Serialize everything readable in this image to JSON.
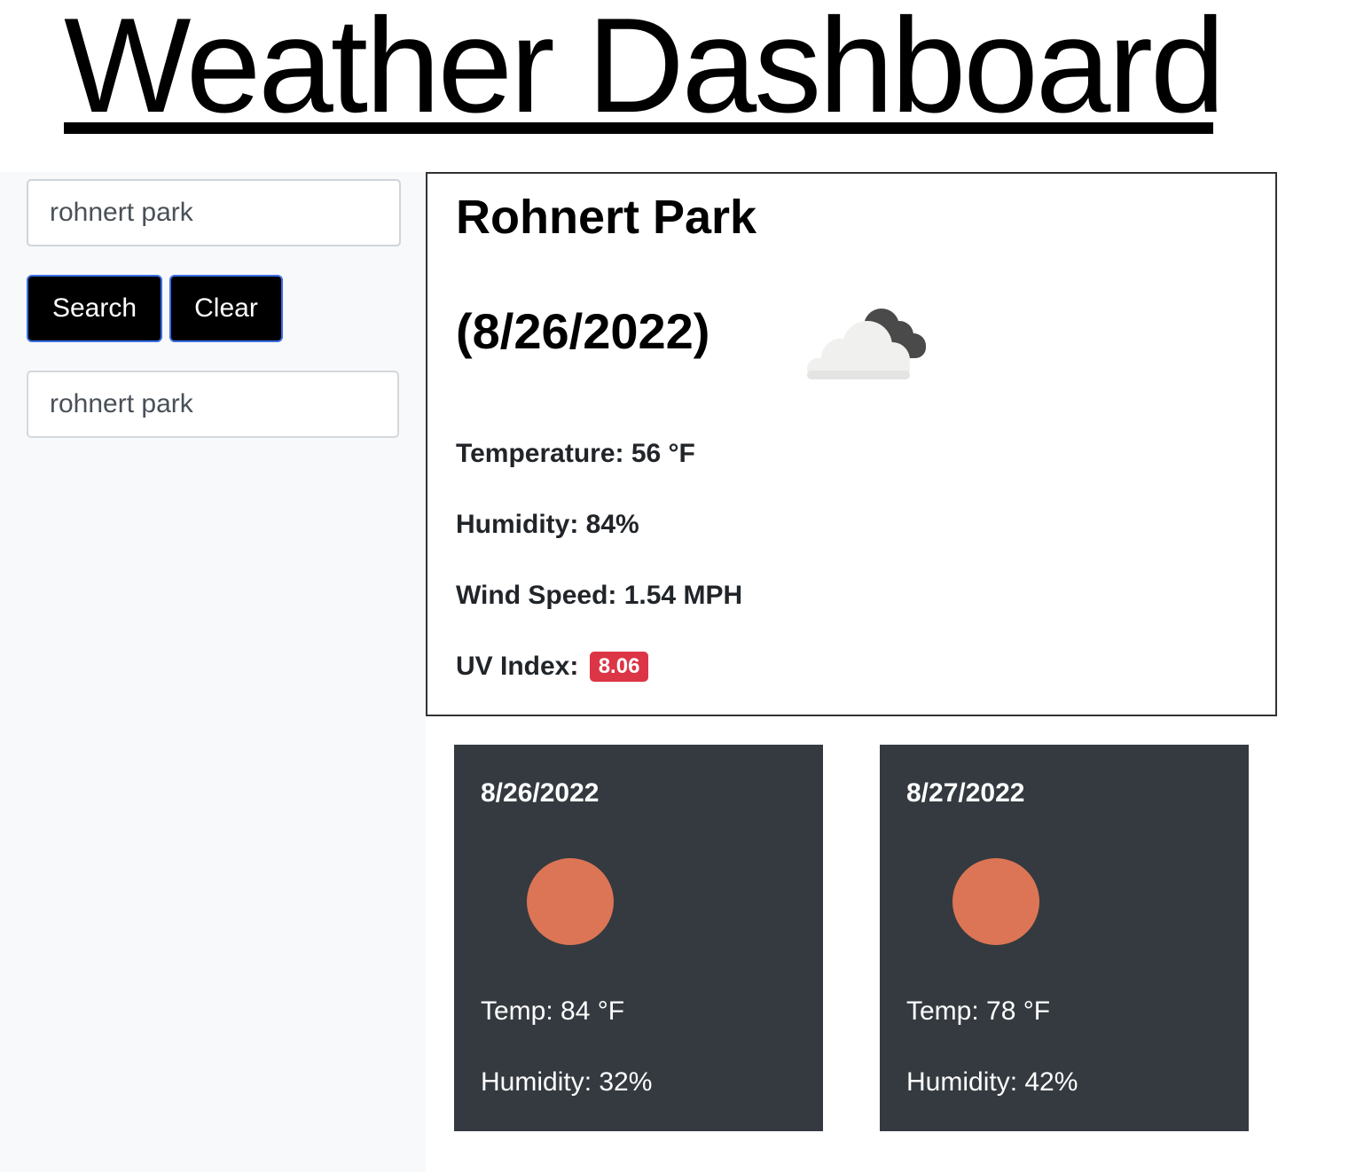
{
  "header": {
    "title": "Weather Dashboard"
  },
  "sidebar": {
    "search": {
      "value": "rohnert park"
    },
    "buttons": {
      "search_label": "Search",
      "clear_label": "Clear"
    },
    "history": [
      {
        "label": "rohnert park"
      }
    ]
  },
  "current": {
    "city": "Rohnert Park",
    "date": "(8/26/2022)",
    "icon": "cloud-icon",
    "temperature": "Temperature: 56 °F",
    "humidity": "Humidity: 84%",
    "wind": "Wind Speed: 1.54 MPH",
    "uv_label": "UV Index:",
    "uv_value": "8.06",
    "uv_color": "#dc3545"
  },
  "forecast": [
    {
      "date": "8/26/2022",
      "icon": "sun-icon",
      "temp": "Temp: 84 °F",
      "humidity": "Humidity: 32%"
    },
    {
      "date": "8/27/2022",
      "icon": "sun-icon",
      "temp": "Temp: 78 °F",
      "humidity": "Humidity: 42%"
    }
  ],
  "colors": {
    "forecast_bg": "#343a40",
    "sun": "#dc7555",
    "button_bg": "#000000",
    "button_border": "#3b6ee6",
    "sidebar_bg": "#f8f9fa"
  }
}
